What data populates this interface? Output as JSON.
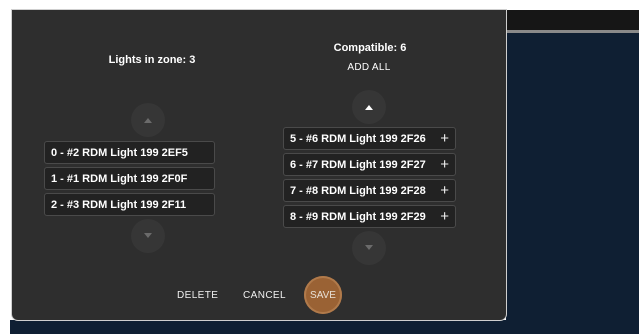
{
  "zone_panel": {
    "title": "Lights in zone: 3",
    "items": [
      {
        "label": "0 - #2 RDM Light 199 2EF5"
      },
      {
        "label": "1 - #1 RDM Light 199 2F0F"
      },
      {
        "label": "2 - #3 RDM Light 199 2F11"
      }
    ]
  },
  "compatible_panel": {
    "title": "Compatible: 6",
    "add_all": "ADD ALL",
    "items": [
      {
        "label": "5 - #6 RDM Light 199 2F26"
      },
      {
        "label": "6 - #7 RDM Light 199 2F27"
      },
      {
        "label": "7 - #8 RDM Light 199 2F28"
      },
      {
        "label": "8 - #9 RDM Light 199 2F29"
      }
    ],
    "add_glyph": "+"
  },
  "actions": {
    "delete": "DELETE",
    "cancel": "CANCEL",
    "save": "SAVE"
  },
  "colors": {
    "dialog_bg": "#2e2e2e",
    "item_bg": "#222222",
    "save_accent": "#9a6234",
    "backdrop": "#0f1f33"
  },
  "icons": {
    "scroll_up": "chevron-up-icon",
    "scroll_down": "chevron-down-icon",
    "add": "plus-icon"
  }
}
